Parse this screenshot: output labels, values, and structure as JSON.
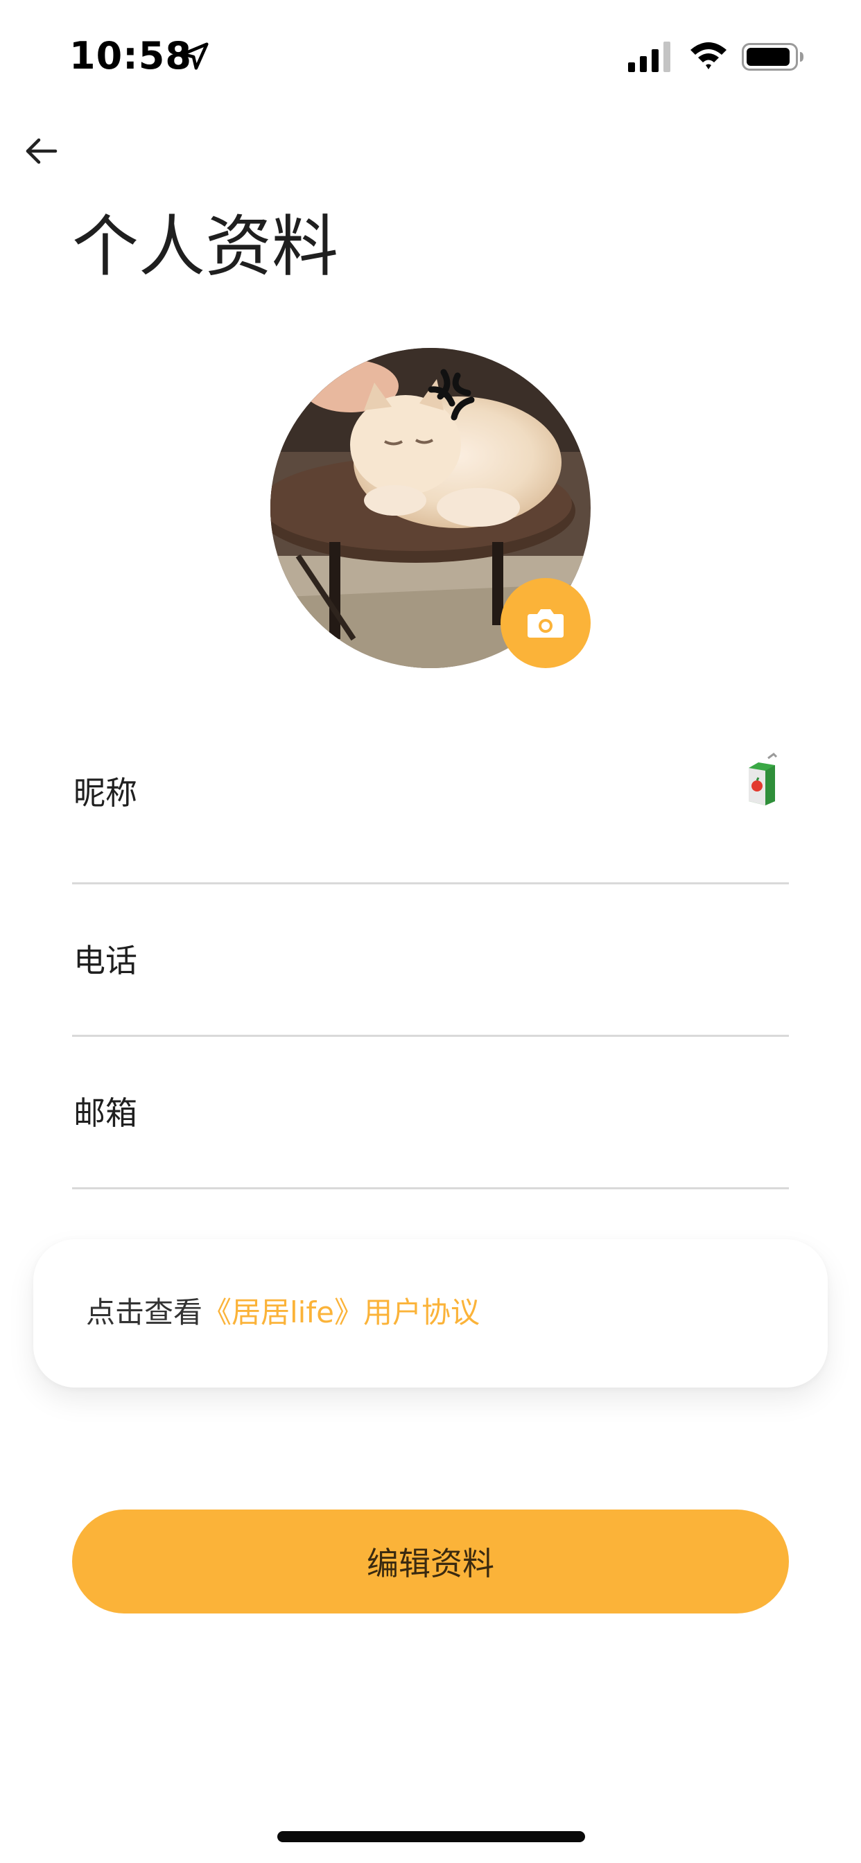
{
  "status_bar": {
    "time": "10:58",
    "location_icon": "location-arrow-icon",
    "signal_icon": "cellular-signal-icon",
    "wifi_icon": "wifi-icon",
    "battery_icon": "battery-icon"
  },
  "header": {
    "back_icon": "arrow-left-icon",
    "title": "个人资料"
  },
  "avatar": {
    "image": "cat-photo",
    "camera_icon": "camera-icon"
  },
  "fields": [
    {
      "label": "昵称",
      "value_icon": "juice-box-emoji"
    },
    {
      "label": "电话"
    },
    {
      "label": "邮箱"
    }
  ],
  "agreement": {
    "prefix": "点击查看",
    "link": "《居居life》用户协议"
  },
  "edit_button": {
    "label": "编辑资料"
  },
  "colors": {
    "accent": "#fbb339",
    "divider": "#d9d9d9",
    "text": "#1f1f1f"
  }
}
